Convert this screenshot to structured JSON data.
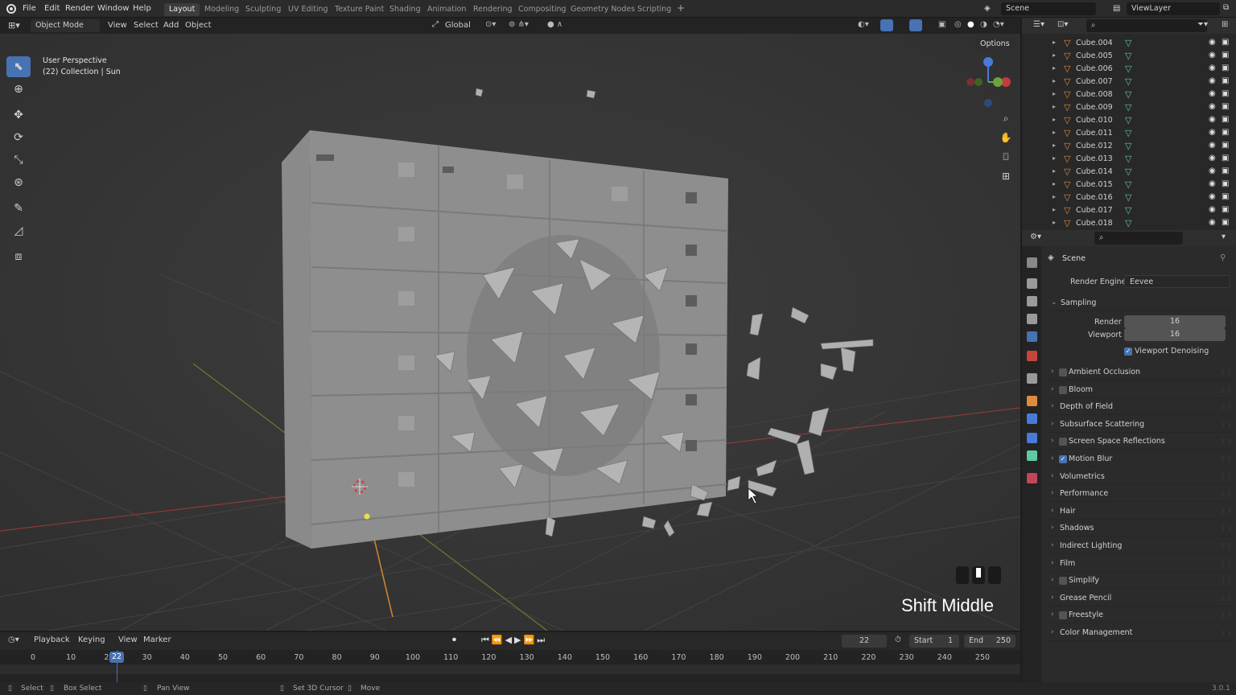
{
  "menu": [
    "File",
    "Edit",
    "Render",
    "Window",
    "Help"
  ],
  "workspaces": [
    "Layout",
    "Modeling",
    "Sculpting",
    "UV Editing",
    "Texture Paint",
    "Shading",
    "Animation",
    "Rendering",
    "Compositing",
    "Geometry Nodes",
    "Scripting"
  ],
  "active_workspace": "Layout",
  "scene_name": "Scene",
  "view_layer": "ViewLayer",
  "viewport_header": {
    "mode": "Object Mode",
    "menus": [
      "View",
      "Select",
      "Add",
      "Object"
    ],
    "orientation": "Global",
    "options": "Options"
  },
  "overlay_text": {
    "line1": "User Perspective",
    "line2": "(22) Collection | Sun"
  },
  "keycast": "Shift Middle",
  "outliner": {
    "items": [
      "Cube.004",
      "Cube.005",
      "Cube.006",
      "Cube.007",
      "Cube.008",
      "Cube.009",
      "Cube.010",
      "Cube.011",
      "Cube.012",
      "Cube.013",
      "Cube.014",
      "Cube.015",
      "Cube.016",
      "Cube.017",
      "Cube.018"
    ]
  },
  "properties": {
    "context": "Scene",
    "render_engine_label": "Render Engine",
    "render_engine": "Eevee",
    "sampling_label": "Sampling",
    "render_label": "Render",
    "render_samples": "16",
    "viewport_label": "Viewport",
    "viewport_samples": "16",
    "viewport_denoising": "Viewport Denoising",
    "panels": [
      {
        "label": "Ambient Occlusion",
        "checkbox": true,
        "checked": false
      },
      {
        "label": "Bloom",
        "checkbox": true,
        "checked": false
      },
      {
        "label": "Depth of Field",
        "checkbox": false
      },
      {
        "label": "Subsurface Scattering",
        "checkbox": false
      },
      {
        "label": "Screen Space Reflections",
        "checkbox": true,
        "checked": false
      },
      {
        "label": "Motion Blur",
        "checkbox": true,
        "checked": true
      },
      {
        "label": "Volumetrics",
        "checkbox": false
      },
      {
        "label": "Performance",
        "checkbox": false
      },
      {
        "label": "Hair",
        "checkbox": false
      },
      {
        "label": "Shadows",
        "checkbox": false
      },
      {
        "label": "Indirect Lighting",
        "checkbox": false
      },
      {
        "label": "Film",
        "checkbox": false
      },
      {
        "label": "Simplify",
        "checkbox": true,
        "checked": false
      },
      {
        "label": "Grease Pencil",
        "checkbox": false
      },
      {
        "label": "Freestyle",
        "checkbox": true,
        "checked": false
      },
      {
        "label": "Color Management",
        "checkbox": false
      }
    ]
  },
  "timeline": {
    "menus": [
      "Playback",
      "Keying",
      "View",
      "Marker"
    ],
    "current_frame": "22",
    "start_label": "Start",
    "start": "1",
    "end_label": "End",
    "end": "250",
    "ticks": [
      "0",
      "10",
      "20",
      "30",
      "40",
      "50",
      "60",
      "70",
      "80",
      "90",
      "100",
      "110",
      "120",
      "130",
      "140",
      "150",
      "160",
      "170",
      "180",
      "190",
      "200",
      "210",
      "220",
      "230",
      "240",
      "250"
    ]
  },
  "status": {
    "items": [
      "Select",
      "Box Select",
      "Pan View",
      "Set 3D Cursor",
      "Move"
    ],
    "version": "3.0.1"
  },
  "colors": {
    "accent": "#4772b3",
    "mesh_icon": "#e08a3c",
    "data_icon": "#5fc9a0"
  }
}
